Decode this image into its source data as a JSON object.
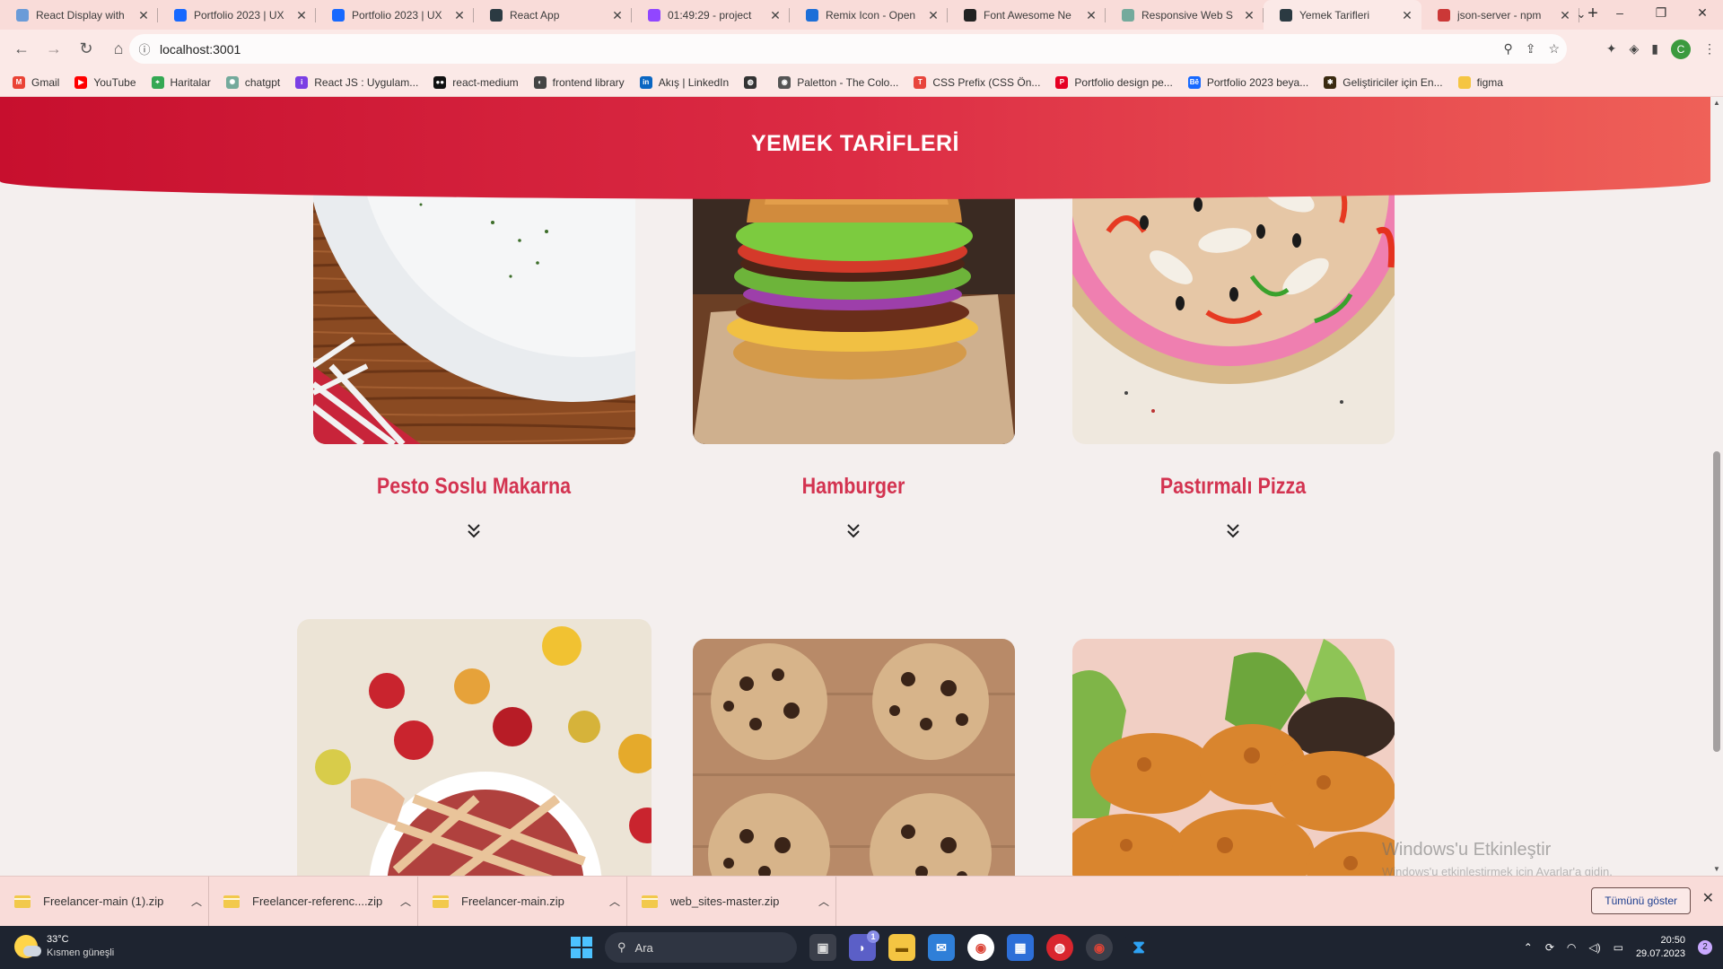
{
  "browser": {
    "tabs": [
      {
        "title": "React Display with",
        "icon": "react-display-favicon",
        "color": "#6a9bd8"
      },
      {
        "title": "Portfolio 2023 | UX",
        "icon": "behance-favicon",
        "color": "#1769ff"
      },
      {
        "title": "Portfolio 2023 | UX",
        "icon": "behance-favicon",
        "color": "#1769ff"
      },
      {
        "title": "React App",
        "icon": "react-favicon",
        "color": "#2b3a42"
      },
      {
        "title": "01:49:29 - project",
        "icon": "twitch-favicon",
        "color": "#9146ff"
      },
      {
        "title": "Remix Icon - Open",
        "icon": "remix-favicon",
        "color": "#1d6fd8"
      },
      {
        "title": "Font Awesome Ne",
        "icon": "yc-favicon",
        "color": "#222222"
      },
      {
        "title": "Responsive Web S",
        "icon": "openai-favicon",
        "color": "#74aa9c"
      },
      {
        "title": "Yemek Tarifleri",
        "icon": "react-favicon",
        "color": "#2b3a42",
        "active": true
      },
      {
        "title": "json-server - npm",
        "icon": "npm-favicon",
        "color": "#cb3837"
      }
    ],
    "new_tab_label": "+",
    "url": "localhost:3001",
    "profile_initial": "C"
  },
  "bookmarks": [
    {
      "label": "Gmail",
      "color": "#ea4335",
      "glyph": "M"
    },
    {
      "label": "YouTube",
      "color": "#ff0000",
      "glyph": "▶"
    },
    {
      "label": "Haritalar",
      "color": "#34a853",
      "glyph": "⌖"
    },
    {
      "label": "chatgpt",
      "color": "#74aa9c",
      "glyph": "✺"
    },
    {
      "label": "React JS : Uygulam...",
      "color": "#7b3fe4",
      "glyph": "i"
    },
    {
      "label": "react-medium",
      "color": "#111111",
      "glyph": "●●"
    },
    {
      "label": "frontend library",
      "color": "#444444",
      "glyph": "◐"
    },
    {
      "label": "Akış | LinkedIn",
      "color": "#0a66c2",
      "glyph": "in"
    },
    {
      "label": "",
      "color": "#333333",
      "glyph": "◍"
    },
    {
      "label": "Paletton - The Colo...",
      "color": "#555555",
      "glyph": "◉"
    },
    {
      "label": "CSS Prefix (CSS Ön...",
      "color": "#e8453c",
      "glyph": "T"
    },
    {
      "label": "Portfolio design pe...",
      "color": "#e60023",
      "glyph": "P"
    },
    {
      "label": "Portfolio 2023 beya...",
      "color": "#1769ff",
      "glyph": "Bē"
    },
    {
      "label": "Geliştiriciler için En...",
      "color": "#3a2a10",
      "glyph": "✱"
    },
    {
      "label": "figma",
      "color": "#f5c542",
      "glyph": ""
    }
  ],
  "page": {
    "header_title": "YEMEK TARİFLERİ",
    "recipes": [
      {
        "title": "Pesto Soslu Makarna",
        "image": "pesto-pasta-photo"
      },
      {
        "title": "Hamburger",
        "image": "hamburger-photo"
      },
      {
        "title": "Pastırmalı Pizza",
        "image": "pizza-photo"
      },
      {
        "title": "",
        "image": "apple-pie-photo"
      },
      {
        "title": "",
        "image": "cookies-photo"
      },
      {
        "title": "",
        "image": "fried-chicken-photo"
      }
    ],
    "watermark_title": "Windows'u Etkinleştir",
    "watermark_sub": "Windows'u etkinleştirmek için Ayarlar'a gidin."
  },
  "downloads": {
    "items": [
      "Freelancer-main (1).zip",
      "Freelancer-referenc....zip",
      "Freelancer-main.zip",
      "web_sites-master.zip"
    ],
    "show_all_label": "Tümünü göster"
  },
  "taskbar": {
    "temperature": "33°C",
    "weather_text": "Kısmen güneşli",
    "search_placeholder": "Ara",
    "time": "20:50",
    "date": "29.07.2023",
    "notification_count": "2",
    "chat_badge": "1"
  }
}
